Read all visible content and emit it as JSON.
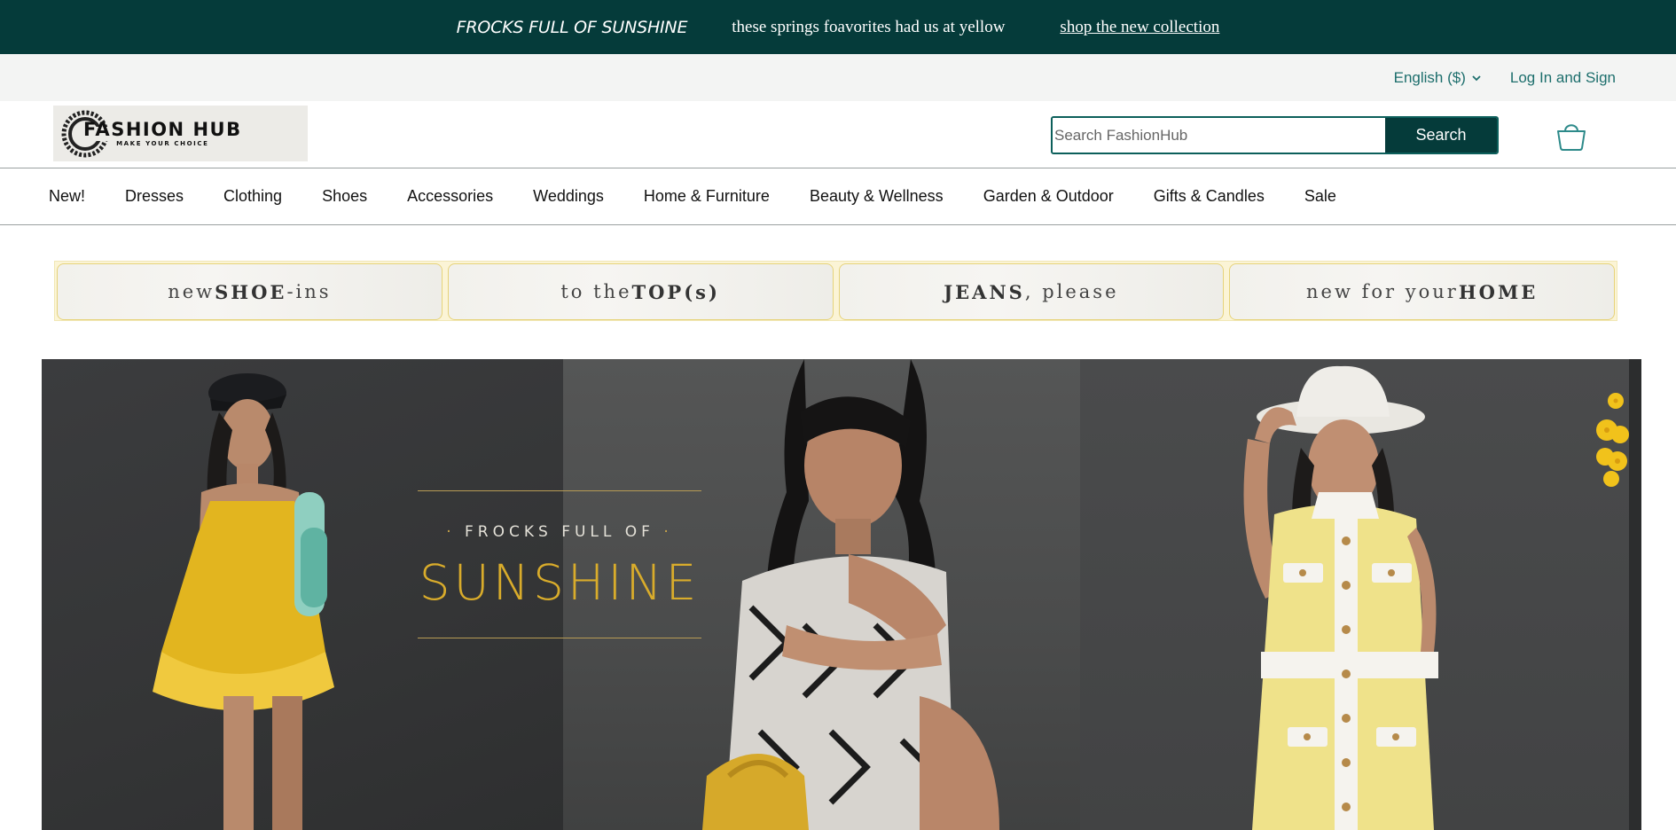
{
  "promo": {
    "title": "FROCKS FULL OF SUNSHINE",
    "subtitle": "these springs foavorites had us at yellow",
    "link": "shop the new collection",
    "bg_color": "#053b3a"
  },
  "utility": {
    "language": "English ($)",
    "login": "Log In and Sign",
    "link_color": "#1c6e6c"
  },
  "header": {
    "logo": {
      "brand": "FASHION HUB",
      "tagline": "MAKE YOUR CHOICE"
    },
    "search": {
      "placeholder": "Search FashionHub",
      "button": "Search"
    },
    "cart_icon": "shopping-bag-icon"
  },
  "nav": {
    "items": [
      "New!",
      "Dresses",
      "Clothing",
      "Shoes",
      "Accessories",
      "Weddings",
      "Home & Furniture",
      "Beauty & Wellness",
      "Garden & Outdoor",
      "Gifts & Candles",
      "Sale"
    ]
  },
  "tiles": [
    {
      "pre": "new ",
      "bold": "SHOE",
      "post": "-ins"
    },
    {
      "pre": "to the ",
      "bold": "TOP(s)",
      "post": ""
    },
    {
      "pre": "",
      "bold": "JEANS",
      "post": ", please"
    },
    {
      "pre": "new for your ",
      "bold": "HOME",
      "post": ""
    }
  ],
  "hero": {
    "kicker": "FROCKS FULL OF",
    "headline": "SUNSHINE",
    "accent_color": "#d9ac2b"
  }
}
